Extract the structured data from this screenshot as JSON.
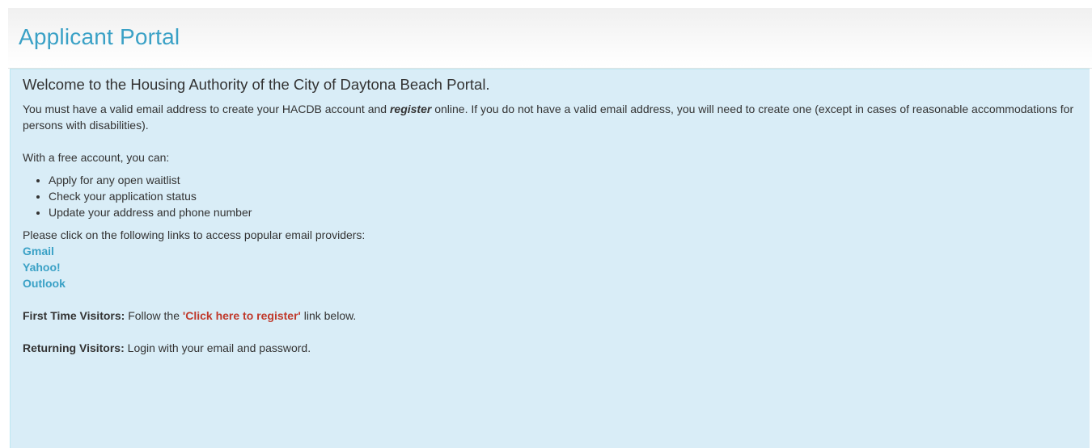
{
  "header": {
    "title": "Applicant Portal"
  },
  "welcome": {
    "heading": "Welcome to the Housing Authority of the City of Daytona Beach Portal.",
    "intro_before": "You must have a valid email address to create your HACDB account and ",
    "intro_emph": "register",
    "intro_after": " online. If you do not have a valid email address, you will need to create one (except in cases of reasonable accommodations for persons with disabilities).",
    "free_account": "With a free account, you can:",
    "benefits": [
      "Apply for any open waitlist",
      "Check your application status",
      "Update your address and phone number"
    ],
    "providers_intro": "Please click on the following links to access popular email providers:",
    "providers": [
      "Gmail",
      "Yahoo!",
      "Outlook"
    ],
    "first_time": {
      "label": "First Time Visitors:",
      "before": " Follow the ",
      "link": "'Click here to register'",
      "after": " link below."
    },
    "returning": {
      "label": "Returning Visitors:",
      "text": " Login with your email and password."
    }
  },
  "colors": {
    "title": "#3aa1c6",
    "panel_bg": "#d9edf7",
    "link": "#3aa1c6",
    "register_link": "#c0392b"
  }
}
